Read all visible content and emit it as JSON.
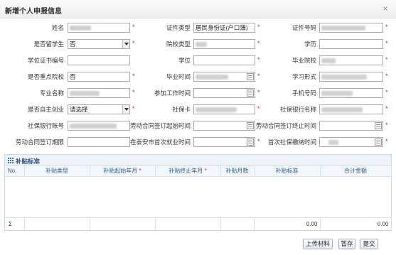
{
  "dialog": {
    "title": "新增个人申报信息",
    "close": "×"
  },
  "form": {
    "row1": {
      "name_label": "姓名",
      "name_value": "",
      "id_type_label": "证件类型",
      "id_type_value": "居民身份证(户口簿)",
      "id_no_label": "证件号码",
      "id_no_value": ""
    },
    "row2": {
      "graduate_label": "是否留学生",
      "graduate_value": "否",
      "college_type_label": "院校类型",
      "college_type_value": "",
      "education_label": "学历",
      "education_value": ""
    },
    "row3": {
      "degree_no_label": "学位证书编号",
      "degree_no_value": "",
      "degree_label": "学位",
      "degree_value": "",
      "school_label": "毕业院校",
      "school_value": ""
    },
    "row4": {
      "key_college_label": "是否重点院校",
      "key_college_value": "否",
      "grad_time_label": "毕业时间",
      "grad_time_value": "",
      "study_form_label": "学习形式",
      "study_form_value": ""
    },
    "row5": {
      "major_label": "专业名称",
      "major_value": "",
      "work_time_label": "参加工作时间",
      "work_time_value": "",
      "phone_label": "手机号码",
      "phone_value": ""
    },
    "row6": {
      "self_employ_label": "是否自主创业",
      "self_employ_value": "请选择",
      "social_card_label": "社保卡",
      "social_card_value": "",
      "bank_label": "社保银行名称",
      "bank_value": ""
    },
    "row7": {
      "bank_account_label": "社保银行账号",
      "bank_account_value": "",
      "contract_start_label": "劳动合同签订起始时间",
      "contract_start_value": "",
      "contract_end_label": "劳动合同签订终止时间",
      "contract_end_value": ""
    },
    "row8": {
      "contract_term_label": "劳动合同签订期限",
      "contract_term_value": "",
      "first_employ_label": "在泰安市首次就业时间",
      "first_employ_value": "",
      "first_pay_label": "首次社保缴纳时间",
      "first_pay_value": ""
    },
    "required_mark": "*"
  },
  "subsidy": {
    "title": "补贴标准",
    "columns": [
      "No.",
      "补贴类型",
      "补贴起始年月",
      "补贴终止年月",
      "补贴月数",
      "补贴标准",
      "合计金额"
    ],
    "sum_row": [
      "Σ",
      "",
      "",
      "",
      "",
      "0.00",
      "0.00"
    ]
  },
  "buttons": {
    "upload": "上传材料",
    "save": "暂存",
    "submit": "提交"
  }
}
